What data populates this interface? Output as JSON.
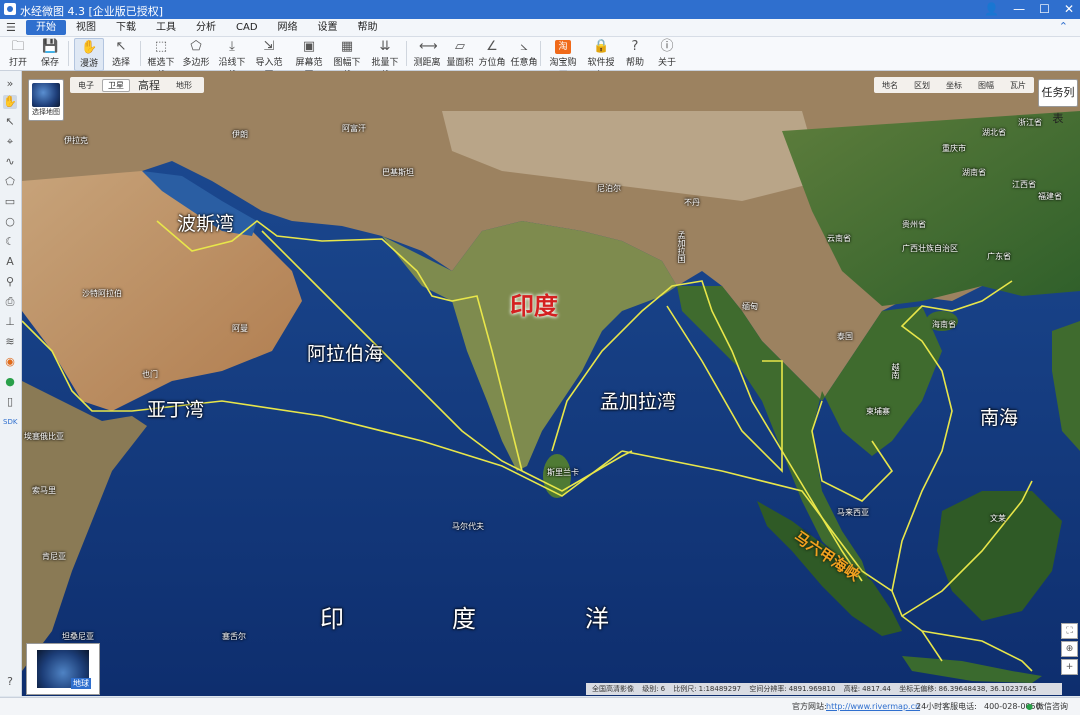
{
  "window": {
    "title": "水经微图 4.3 [企业版已授权]",
    "controls": [
      "👤",
      "—",
      "☐",
      "✕"
    ]
  },
  "menu": {
    "items": [
      "开始",
      "视图",
      "下载",
      "工具",
      "分析",
      "CAD",
      "网络",
      "设置",
      "帮助"
    ],
    "active": "开始"
  },
  "toolbar": {
    "buttons": [
      {
        "label": "打开",
        "icon": "folder-icon"
      },
      {
        "label": "保存",
        "icon": "save-icon"
      },
      {
        "label": "漫游",
        "icon": "hand-icon",
        "active": true
      },
      {
        "label": "选择",
        "icon": "pointer-icon"
      },
      {
        "label": "框选下载",
        "icon": "box-download-icon"
      },
      {
        "label": "多边形",
        "icon": "polygon-icon"
      },
      {
        "label": "沿线下载",
        "icon": "line-download-icon"
      },
      {
        "label": "导入范围",
        "icon": "import-range-icon"
      },
      {
        "label": "屏幕范围",
        "icon": "screen-range-icon"
      },
      {
        "label": "图幅下载",
        "icon": "sheet-download-icon"
      },
      {
        "label": "批量下载",
        "icon": "batch-download-icon"
      },
      {
        "label": "测距离",
        "icon": "ruler-icon"
      },
      {
        "label": "量面积",
        "icon": "area-icon"
      },
      {
        "label": "方位角",
        "icon": "azimuth-icon"
      },
      {
        "label": "任意角",
        "icon": "angle-icon"
      },
      {
        "label": "淘宝购买",
        "icon": "taobao-icon"
      },
      {
        "label": "软件授权",
        "icon": "lock-icon"
      },
      {
        "label": "帮助",
        "icon": "help-icon"
      },
      {
        "label": "关于",
        "icon": "info-icon"
      }
    ]
  },
  "map": {
    "basemap_selector_label": "选择地图",
    "map_types": [
      "电子",
      "卫星",
      "高程",
      "地形"
    ],
    "selected_map_type": "卫星",
    "right_tools": [
      "地名",
      "区划",
      "坐标",
      "图幅",
      "瓦片"
    ],
    "task_button": "任务列表",
    "bottom_thumb_label": "地球",
    "annotations": {
      "persian_gulf": "波斯湾",
      "india": "印度",
      "arabian_sea": "阿拉伯海",
      "gulf_of_aden": "亚丁湾",
      "bay_of_bengal": "孟加拉湾",
      "south_china_sea": "南海",
      "malacca_strait": "马六甲海峡",
      "indian_ocean_1": "印",
      "indian_ocean_2": "度",
      "indian_ocean_3": "洋"
    },
    "place_labels": [
      "伊拉克",
      "伊朗",
      "阿富汗",
      "巴基斯坦",
      "沙特阿拉伯",
      "阿曼",
      "也门",
      "索马里",
      "埃塞俄比亚",
      "肯尼亚",
      "坦桑尼亚",
      "尼泊尔",
      "不丹",
      "孟加拉国",
      "缅甸",
      "泰国",
      "柬埔寨",
      "越南",
      "斯里兰卡",
      "马尔代夫",
      "马来西亚",
      "文莱",
      "海南省",
      "云南省",
      "贵州省",
      "广西壮族自治区",
      "广东省",
      "湖南省",
      "江西省",
      "福建省",
      "浙江省",
      "重庆市",
      "湖北省",
      "塞舌尔"
    ]
  },
  "map_status": {
    "layer": "全国高清影像",
    "level_label": "级别:",
    "level": "6",
    "scale_label": "比例尺:",
    "scale": "1:18489297",
    "resolution_label": "空间分辨率:",
    "resolution": "4891.969810",
    "elevation_label": "高程:",
    "elevation": "4817.44",
    "no_offset_label": "坐标无偏移:",
    "coords": "86.39648438, 36.10237645"
  },
  "statusbar": {
    "website_label": "官方网站:",
    "website": "http://www.rivermap.cn",
    "hotline_label": "24小时客服电话:",
    "hotline": "400-028-0050",
    "wechat": "微信咨询"
  }
}
